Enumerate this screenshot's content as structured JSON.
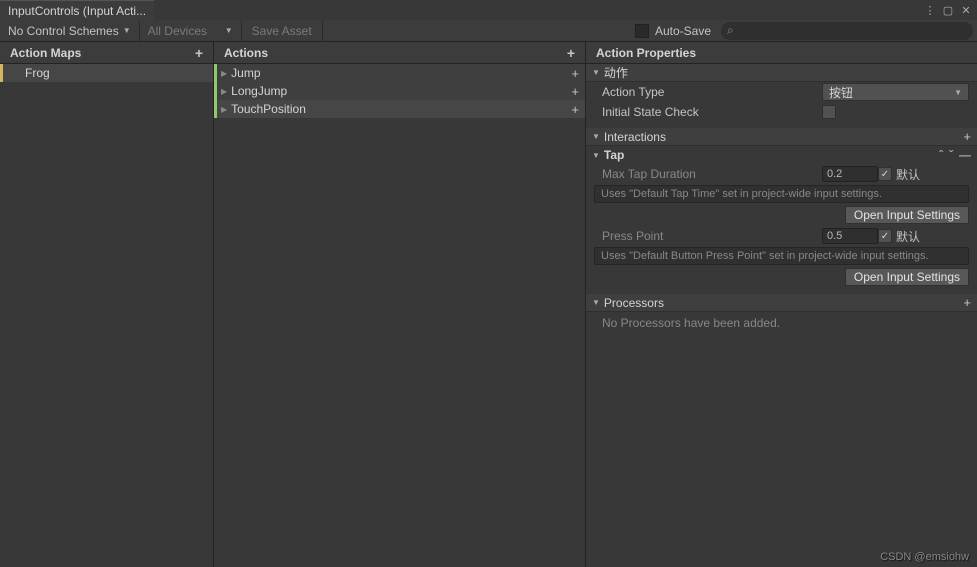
{
  "window": {
    "title": "InputControls (Input Acti..."
  },
  "toolbar": {
    "schemes": "No Control Schemes",
    "devices": "All Devices",
    "save": "Save Asset",
    "autosave": "Auto-Save"
  },
  "columns": {
    "maps_header": "Action Maps",
    "actions_header": "Actions",
    "props_header": "Action Properties"
  },
  "maps": {
    "items": [
      {
        "name": "Frog"
      }
    ]
  },
  "actions": {
    "items": [
      {
        "name": "Jump"
      },
      {
        "name": "LongJump"
      },
      {
        "name": "TouchPosition"
      }
    ]
  },
  "properties": {
    "section_action": "动作",
    "action_type_label": "Action Type",
    "action_type_value": "按钮",
    "initial_state_label": "Initial State Check",
    "section_interactions": "Interactions",
    "tap_header": "Tap",
    "max_tap_label": "Max Tap Duration",
    "max_tap_value": "0.2",
    "default_label": "默认",
    "max_tap_hint": "Uses \"Default Tap Time\" set in project-wide input settings.",
    "open_settings": "Open Input Settings",
    "press_point_label": "Press Point",
    "press_point_value": "0.5",
    "press_point_hint": "Uses \"Default Button Press Point\" set in project-wide input settings.",
    "section_processors": "Processors",
    "processors_empty": "No Processors have been added."
  },
  "watermark": "CSDN @emsiohw"
}
